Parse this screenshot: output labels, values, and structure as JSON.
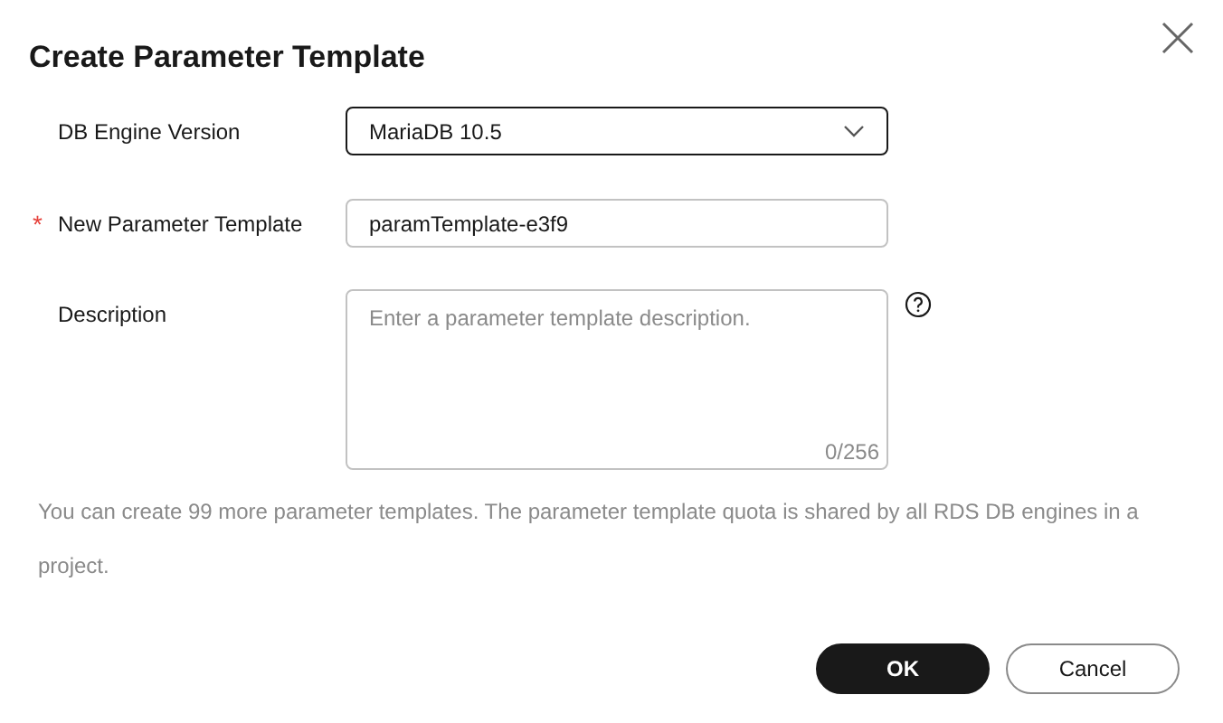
{
  "dialog": {
    "title": "Create Parameter Template"
  },
  "fields": [
    {
      "kind": "select",
      "label": "DB Engine Version",
      "value": "MariaDB 10.5"
    },
    {
      "kind": "text",
      "label": "New Parameter Template",
      "required_mark": "*",
      "value": "paramTemplate-e3f9"
    },
    {
      "kind": "textarea",
      "label": "Description",
      "placeholder": "Enter a parameter template description.",
      "counter": "0/256",
      "help": true
    }
  ],
  "note": "You can create 99 more parameter templates. The parameter template quota is shared by all RDS DB engines in a project.",
  "buttons": [
    {
      "label": "OK",
      "primary": true
    },
    {
      "label": "Cancel",
      "primary": false
    }
  ]
}
